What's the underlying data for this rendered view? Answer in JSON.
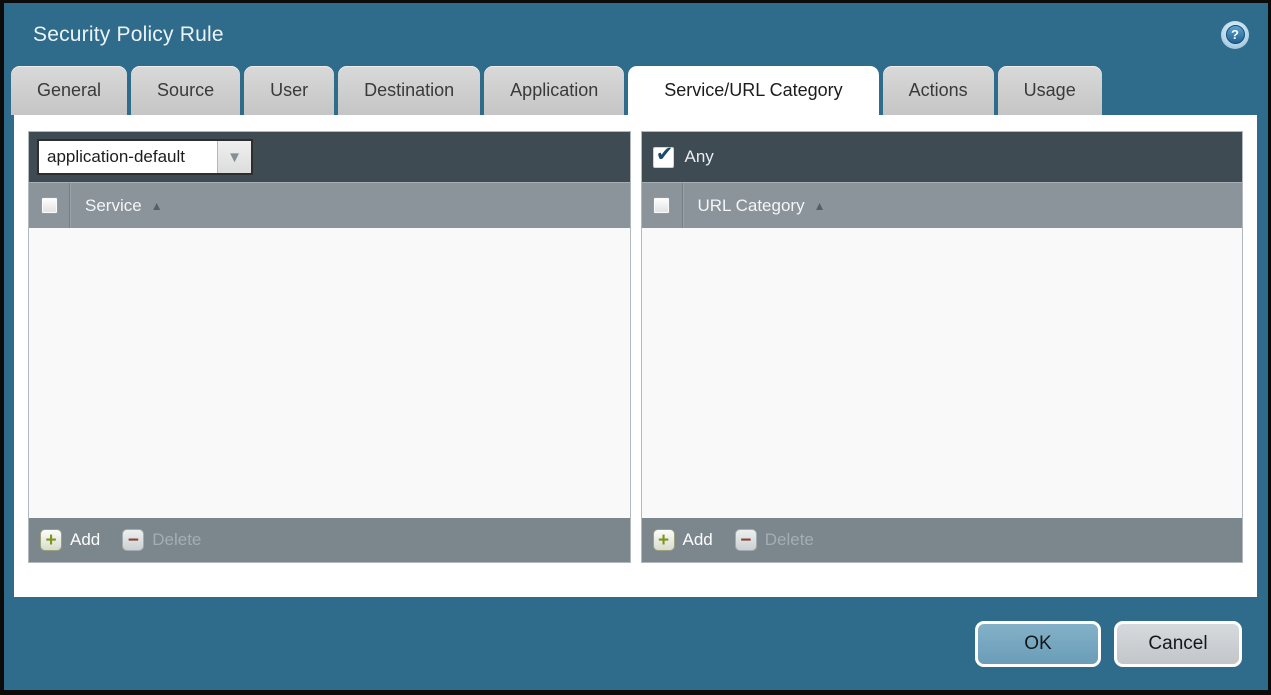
{
  "window": {
    "title": "Security Policy Rule",
    "help_icon": "?"
  },
  "tabs": {
    "active": "Service/URL Category",
    "items": [
      {
        "label": "General"
      },
      {
        "label": "Source"
      },
      {
        "label": "User"
      },
      {
        "label": "Destination"
      },
      {
        "label": "Application"
      },
      {
        "label": "Service/URL Category"
      },
      {
        "label": "Actions"
      },
      {
        "label": "Usage"
      }
    ]
  },
  "service_panel": {
    "dropdown": {
      "value": "application-default",
      "arrow_icon": "▼"
    },
    "header": {
      "label": "Service",
      "checkbox_checked": false,
      "sort_icon": "▲",
      "sort_order": "ascending"
    },
    "rows": [],
    "footer": {
      "add_label": "Add",
      "add_icon": "+",
      "delete_label": "Delete",
      "delete_icon": "−",
      "delete_enabled": false
    }
  },
  "url_category_panel": {
    "any": {
      "label": "Any",
      "checked": true,
      "check_icon": "✔"
    },
    "header": {
      "label": "URL Category",
      "checkbox_checked": false,
      "sort_icon": "▲",
      "sort_order": "ascending"
    },
    "rows": [],
    "footer": {
      "add_label": "Add",
      "add_icon": "+",
      "delete_label": "Delete",
      "delete_icon": "−",
      "delete_enabled": false
    }
  },
  "dialog_buttons": {
    "ok_label": "OK",
    "cancel_label": "Cancel"
  },
  "colors": {
    "background_teal": "#2f6c8c",
    "toolbar_dark": "#3e4b53",
    "table_header_gray": "#8b949b",
    "footer_bar_gray": "#7c868d",
    "list_background": "#f8f9f8",
    "active_tab": "#ffffff",
    "inactive_tab": "#cdcdcd",
    "ok_button_blue": "#74a5bf",
    "cancel_button_gray": "#cbcfd2",
    "add_icon_green": "#7b9420",
    "delete_icon_red": "#8c4136",
    "check_mark_navy": "#1d4a68"
  }
}
